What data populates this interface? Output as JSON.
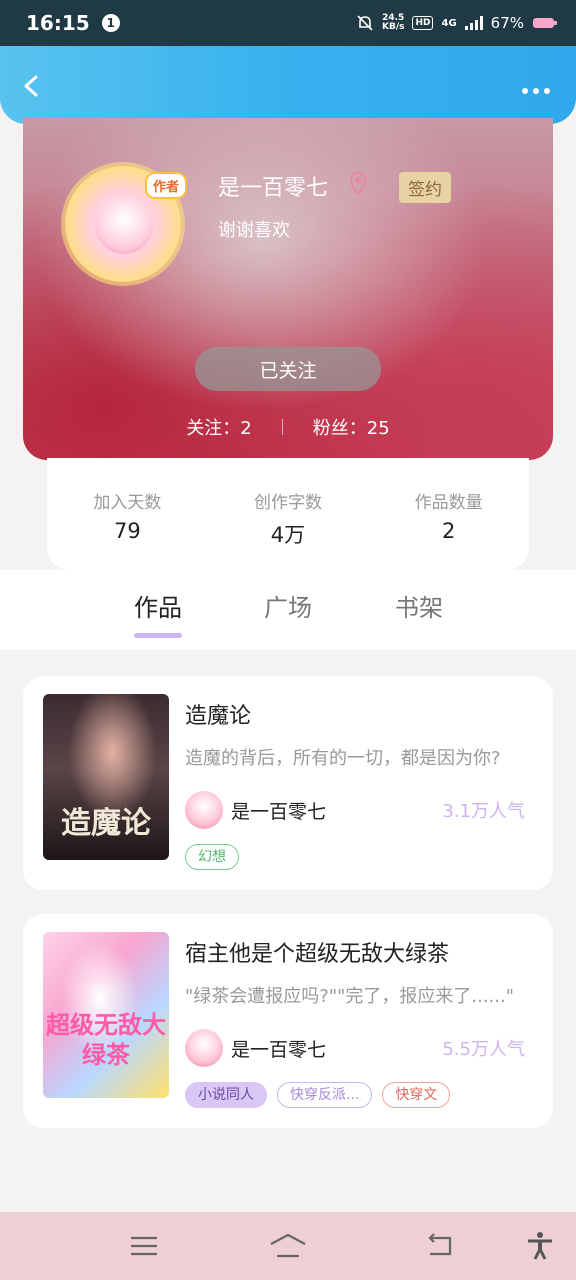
{
  "status_bar": {
    "time": "16:15",
    "notification_count": "1",
    "net_speed_value": "24.5",
    "net_speed_unit": "KB/s",
    "hd_label": "HD",
    "network": "4G",
    "battery": "67%"
  },
  "header": {
    "back_icon": "chevron-left-icon",
    "more_icon": "more-dots-icon"
  },
  "profile": {
    "author_tag": "作者",
    "name": "是一百零七",
    "sign_badge": "签约",
    "bio": "谢谢喜欢",
    "follow_button": "已关注",
    "following": "关注：2",
    "fans": "粉丝：25"
  },
  "stats": [
    {
      "label": "加入天数",
      "value": "79"
    },
    {
      "label": "创作字数",
      "value": "4万"
    },
    {
      "label": "作品数量",
      "value": "2"
    }
  ],
  "tabs": [
    {
      "label": "作品"
    },
    {
      "label": "广场"
    },
    {
      "label": "书架"
    }
  ],
  "books": [
    {
      "title": "造魔论",
      "cover_text": "造魔论",
      "desc": "造魔的背后，所有的一切，都是因为你?",
      "author": "是一百零七",
      "popularity": "3.1万人气",
      "tags": [
        "幻想"
      ]
    },
    {
      "title": "宿主他是个超级无敌大绿茶",
      "cover_text": "超级无敌大绿茶",
      "desc": "\"绿茶会遭报应吗?\"\"完了，报应来了......\"",
      "author": "是一百零七",
      "popularity": "5.5万人气",
      "tags": [
        "小说同人",
        "快穿反派...",
        "快穿文"
      ]
    }
  ],
  "colors": {
    "header_blue": "#37b1ee",
    "accent_purple": "#cdb5ef",
    "sign_gold": "#e9d2a6",
    "nav_pink": "#edcfd5"
  },
  "nav_bar": {
    "icons": [
      "menu-icon",
      "home-icon",
      "back-icon",
      "accessibility-icon"
    ]
  }
}
